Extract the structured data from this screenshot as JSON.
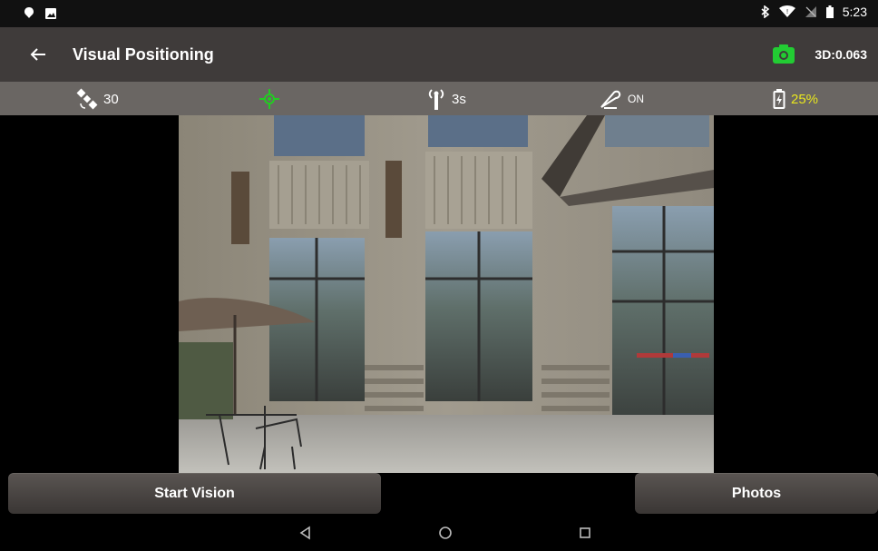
{
  "status_bar": {
    "time": "5:23",
    "left_icons": [
      "notification-icon",
      "image-icon"
    ],
    "right_icons": [
      "bluetooth-icon",
      "wifi-icon",
      "no-sim-icon",
      "battery-icon"
    ]
  },
  "app_bar": {
    "title": "Visual Positioning",
    "precision": "3D:0.063",
    "camera_icon_color": "#22cc33"
  },
  "info_bar": {
    "satellites": "30",
    "fix_icon_color": "#22cc22",
    "interval": "3s",
    "tilt_status": "ON",
    "battery": "25%",
    "battery_color": "#e8e61e"
  },
  "buttons": {
    "start_vision": "Start Vision",
    "photos": "Photos"
  },
  "nav": [
    "back-icon",
    "home-icon",
    "recents-icon"
  ]
}
